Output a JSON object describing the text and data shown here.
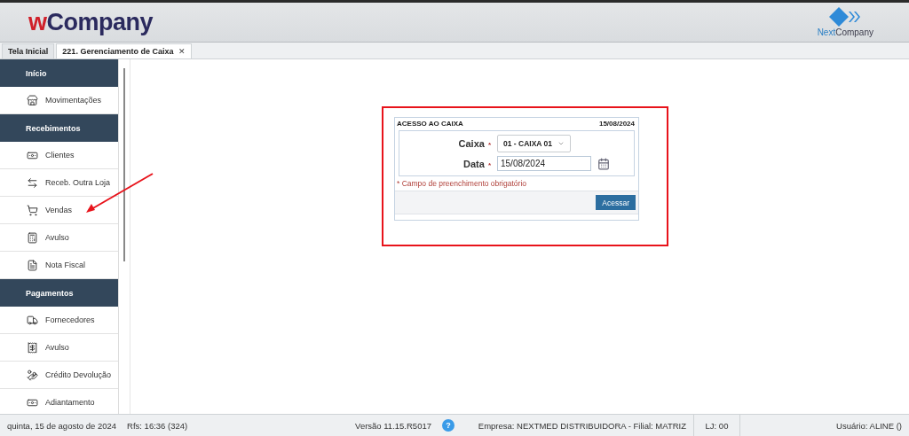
{
  "header": {
    "logo": {
      "prefix": "w",
      "rest": "Company"
    },
    "partner_logo": {
      "first": "Next",
      "second": "Company"
    }
  },
  "tabs": [
    {
      "label": "Tela Inicial",
      "selected": false
    },
    {
      "label": "221. Gerenciamento de Caixa",
      "selected": true,
      "close": "✕"
    }
  ],
  "sidebar": {
    "sections": [
      {
        "title": "Início",
        "items": [
          {
            "label": "Movimentações"
          }
        ]
      },
      {
        "title": "Recebimentos",
        "items": [
          {
            "label": "Clientes"
          },
          {
            "label": "Receb. Outra Loja"
          },
          {
            "label": "Vendas"
          },
          {
            "label": "Avulso"
          },
          {
            "label": "Nota Fiscal"
          }
        ]
      },
      {
        "title": "Pagamentos",
        "items": [
          {
            "label": "Fornecedores"
          },
          {
            "label": "Avulso"
          },
          {
            "label": "Crédito Devolução"
          },
          {
            "label": "Adiantamento"
          }
        ]
      }
    ]
  },
  "dialog": {
    "title": "ACESSO AO CAIXA",
    "date": "15/08/2024",
    "fields": [
      {
        "kind": "select",
        "label": "Caixa",
        "required": "*",
        "value": "01 - CAIXA 01"
      },
      {
        "kind": "date",
        "label": "Data",
        "required": "*",
        "value": "15/08/2024"
      }
    ],
    "note": "* Campo de preenchimento obrigatório",
    "button": "Acessar"
  },
  "status_bar": {
    "date": "quinta, 15 de agosto de 2024",
    "refresh": "Rfs: 16:36 (324)",
    "version": "Versão 11.15.R5017",
    "help": "?",
    "company": "Empresa: NEXTMED DISTRIBUIDORA - Filial: MATRIZ",
    "store": "LJ: 00",
    "user": "Usuário: ALINE ()"
  }
}
